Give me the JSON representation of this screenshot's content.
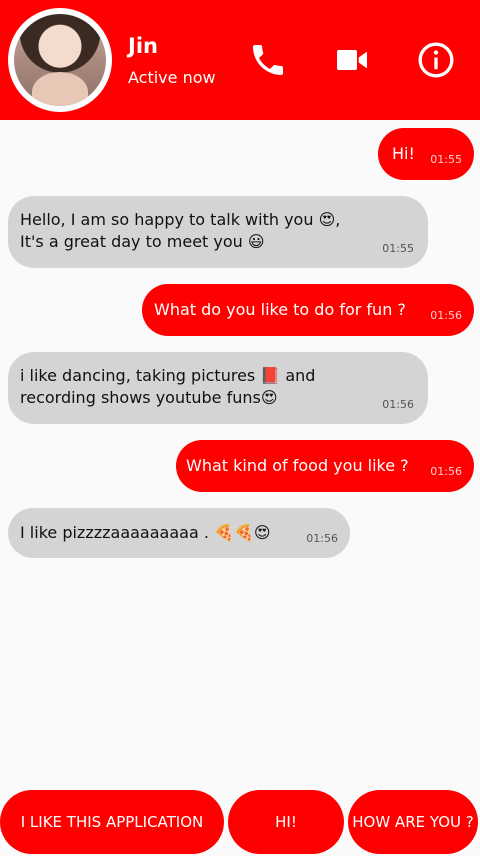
{
  "contact": {
    "name": "Jin",
    "status": "Active now"
  },
  "header_icons": [
    "phone-icon",
    "video-camera-icon",
    "info-icon"
  ],
  "messages": [
    {
      "side": "sent",
      "text": "Hi!",
      "time": "01:55"
    },
    {
      "side": "received",
      "text": "Hello, I am so happy to talk with you 😍,\nIt's a great day to meet you 😃",
      "time": "01:55"
    },
    {
      "side": "sent",
      "text": "What do you like to do for fun ?",
      "time": "01:56"
    },
    {
      "side": "received",
      "text": "i like dancing, taking pictures 📕 and\nrecording shows youtube funs😍",
      "time": "01:56"
    },
    {
      "side": "sent",
      "text": "What kind of food you like ?",
      "time": "01:56"
    },
    {
      "side": "received",
      "text": "I like pizzzzaaaaaaaaa . 🍕🍕😍",
      "time": "01:56"
    }
  ],
  "quick_replies": [
    "I LIKE THIS APPLICATION",
    "HI!",
    "HOW ARE YOU ?"
  ],
  "colors": {
    "accent": "#ff0000",
    "received_bubble": "#d4d4d4",
    "background": "#fafafa"
  }
}
